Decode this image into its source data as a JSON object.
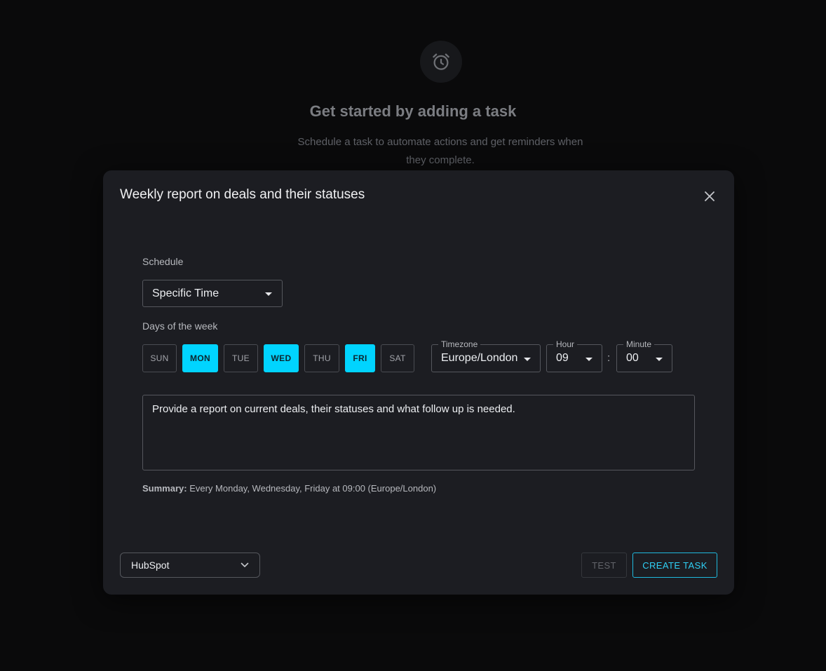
{
  "empty_state": {
    "icon": "alarm-clock-icon",
    "title": "Get started by adding a task",
    "description": "Schedule a task to automate actions and get reminders when they complete."
  },
  "modal": {
    "title": "Weekly report on deals and their statuses",
    "close_icon": "close-icon",
    "schedule": {
      "label": "Schedule",
      "value": "Specific Time"
    },
    "days": {
      "label": "Days of the week",
      "items": [
        {
          "label": "SUN",
          "active": false
        },
        {
          "label": "MON",
          "active": true
        },
        {
          "label": "TUE",
          "active": false
        },
        {
          "label": "WED",
          "active": true
        },
        {
          "label": "THU",
          "active": false
        },
        {
          "label": "FRI",
          "active": true
        },
        {
          "label": "SAT",
          "active": false
        }
      ]
    },
    "timezone": {
      "label": "Timezone",
      "value": "Europe/London"
    },
    "hour": {
      "label": "Hour",
      "value": "09"
    },
    "time_separator": ":",
    "minute": {
      "label": "Minute",
      "value": "00"
    },
    "prompt": "Provide a report on current deals, their statuses and what follow up is needed.",
    "summary": {
      "label": "Summary:",
      "text": "Every Monday, Wednesday, Friday at 09:00 (Europe/London)"
    },
    "integration": {
      "value": "HubSpot"
    },
    "test_label": "TEST",
    "create_label": "CREATE TASK"
  },
  "colors": {
    "accent": "#00d4ff",
    "background": "#0a0a0b",
    "modal_bg": "#1c1d22"
  }
}
